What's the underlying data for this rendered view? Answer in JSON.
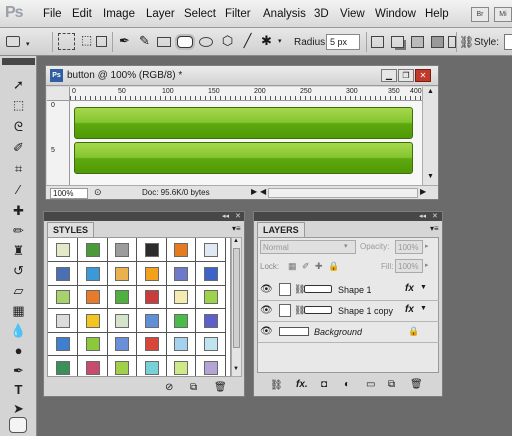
{
  "app": {
    "logo": "Ps"
  },
  "menu": [
    "File",
    "Edit",
    "Image",
    "Layer",
    "Select",
    "Filter",
    "Analysis",
    "3D",
    "View",
    "Window",
    "Help"
  ],
  "menu_right": [
    "Br",
    "Mi"
  ],
  "options": {
    "radius_label": "Radius:",
    "radius_value": "5 px",
    "style_label": "Style:"
  },
  "document": {
    "title": "button @ 100% (RGB/8) *",
    "zoom": "100%",
    "doc_info": "Doc: 95.6K/0 bytes",
    "ruler_h": [
      "0",
      "50",
      "100",
      "150",
      "200",
      "250",
      "300",
      "350",
      "400"
    ],
    "ruler_v": [
      "0",
      "5"
    ]
  },
  "styles_panel": {
    "tab": "STYLES",
    "swatches": [
      [
        "#e4eac9",
        "#4a9a3a",
        "#9c9c9c",
        "#2c2c2c",
        "#e67a1e",
        "#dfe9f4"
      ],
      [
        "#4b6fb3",
        "#3a9ad8",
        "#e9b24d",
        "#f3a01b",
        "#6e79c7",
        "#3e63c8"
      ],
      [
        "#a8d36c",
        "#e87a2b",
        "#4faf3f",
        "#c93c3c",
        "#f4ebb2",
        "#9ed24c"
      ],
      [
        "#dcdcdc",
        "#f2c61f",
        "#d6e3cb",
        "#5f8fd6",
        "#4abb4a",
        "#5d60c9"
      ],
      [
        "#3f7fd0",
        "#89c93a",
        "#6a8ed8",
        "#d8463a",
        "#a5d1ee",
        "#bfe4f0"
      ],
      [
        "#3a8f5a",
        "#c94a6a",
        "#a2cf4a",
        "#7ad0d8",
        "#cfe98a",
        "#b5a3d8"
      ]
    ]
  },
  "layers_panel": {
    "tab": "LAYERS",
    "blend_mode": "Normal",
    "opacity_label": "Opacity:",
    "opacity_value": "100%",
    "lock_label": "Lock:",
    "fill_label": "Fill:",
    "fill_value": "100%",
    "layers": [
      {
        "name": "Shape 1",
        "fx": "fx"
      },
      {
        "name": "Shape 1 copy",
        "fx": "fx"
      },
      {
        "name": "Background",
        "fx": ""
      }
    ]
  },
  "colors": {
    "chrome": "#d6d6d6",
    "workspace": "#6b6b6b",
    "button_green": "#5ea90f"
  }
}
